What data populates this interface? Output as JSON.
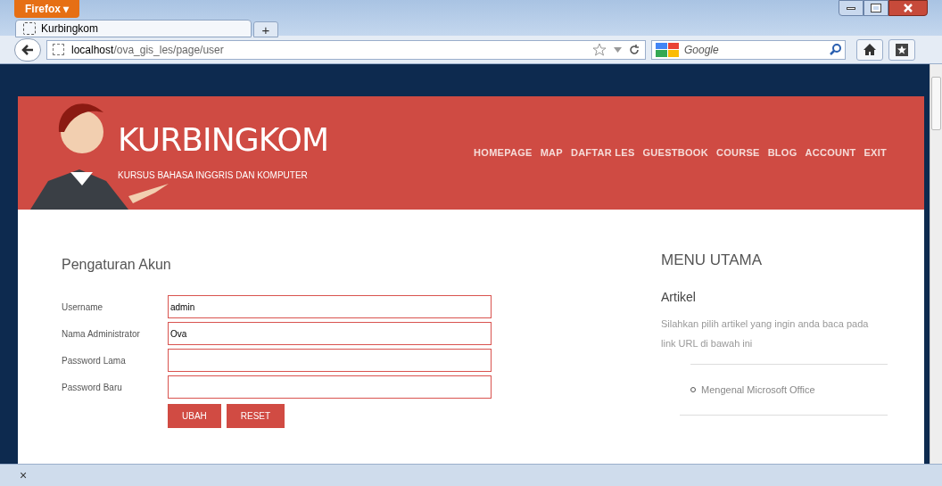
{
  "browser": {
    "menu_button": "Firefox ▾",
    "tab": {
      "title": "Kurbingkom",
      "selected": true
    },
    "new_tab": "+",
    "address": {
      "host": "localhost",
      "path": "/ova_gis_les/page/user"
    },
    "search": {
      "placeholder": "Google"
    },
    "status_close": "×"
  },
  "site": {
    "title": "KURBINGKOM",
    "tagline": "KURSUS BAHASA INGGRIS DAN KOMPUTER",
    "nav": [
      "HOMEPAGE",
      "MAP",
      "DAFTAR LES",
      "GUESTBOOK",
      "COURSE",
      "BLOG",
      "ACCOUNT",
      "EXIT"
    ]
  },
  "form": {
    "title": "Pengaturan Akun",
    "fields": [
      {
        "label": "Username",
        "value": "admin"
      },
      {
        "label": "Nama Administrator",
        "value": "Ova"
      },
      {
        "label": "Password Lama"
      },
      {
        "label": "Password Baru"
      }
    ],
    "buttons": [
      "UBAH",
      "RESET"
    ]
  },
  "sidebar": {
    "title": "MENU UTAMA",
    "section": "Artikel",
    "text": "Silahkan pilih artikel yang ingin anda baca pada link URL di bawah ini",
    "links": [
      "Mengenal Microsoft Office"
    ]
  }
}
